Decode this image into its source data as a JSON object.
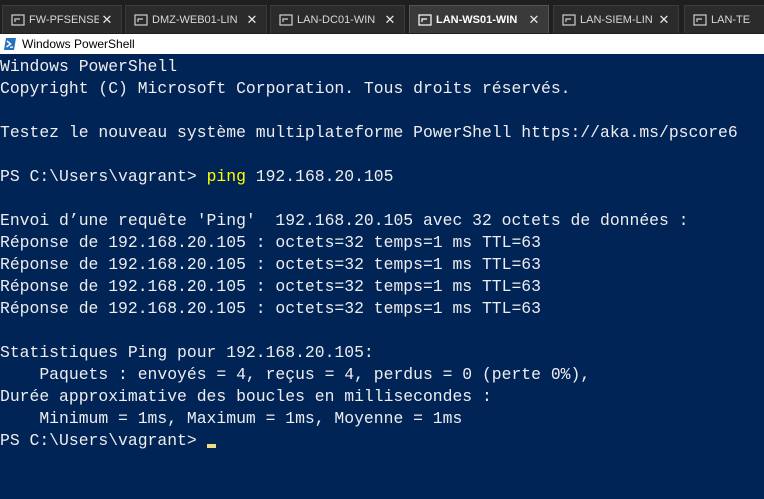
{
  "tabs": [
    {
      "label": "FW-PFSENSE",
      "close": "✕"
    },
    {
      "label": "DMZ-WEB01-LIN",
      "close": "✕"
    },
    {
      "label": "LAN-DC01-WIN",
      "close": "✕"
    },
    {
      "label": "LAN-WS01-WIN",
      "close": "✕",
      "active": true
    },
    {
      "label": "LAN-SIEM-LIN",
      "close": "✕"
    },
    {
      "label": "LAN-TEST-LI",
      "close": ""
    }
  ],
  "window": {
    "title": "Windows PowerShell"
  },
  "console": {
    "lines": [
      "Windows PowerShell",
      "Copyright (C) Microsoft Corporation. Tous droits réservés.",
      "",
      "Testez le nouveau système multiplateforme PowerShell https://aka.ms/pscore6",
      "",
      "",
      "",
      "Envoi d’une requête 'Ping'  192.168.20.105 avec 32 octets de données :",
      "Réponse de 192.168.20.105 : octets=32 temps=1 ms TTL=63",
      "Réponse de 192.168.20.105 : octets=32 temps=1 ms TTL=63",
      "Réponse de 192.168.20.105 : octets=32 temps=1 ms TTL=63",
      "Réponse de 192.168.20.105 : octets=32 temps=1 ms TTL=63",
      "",
      "Statistiques Ping pour 192.168.20.105:",
      "    Paquets : envoyés = 4, reçus = 4, perdus = 0 (perte 0%),",
      "Durée approximative des boucles en millisecondes :",
      "    Minimum = 1ms, Maximum = 1ms, Moyenne = 1ms"
    ],
    "command_prompt": "PS C:\\Users\\vagrant> ",
    "command_name": "ping",
    "command_args": " 192.168.20.105",
    "final_prompt": "PS C:\\Users\\vagrant>"
  },
  "colors": {
    "console_bg": "#012456",
    "console_fg": "#eeedf0",
    "command_highlight": "#ffff00"
  }
}
